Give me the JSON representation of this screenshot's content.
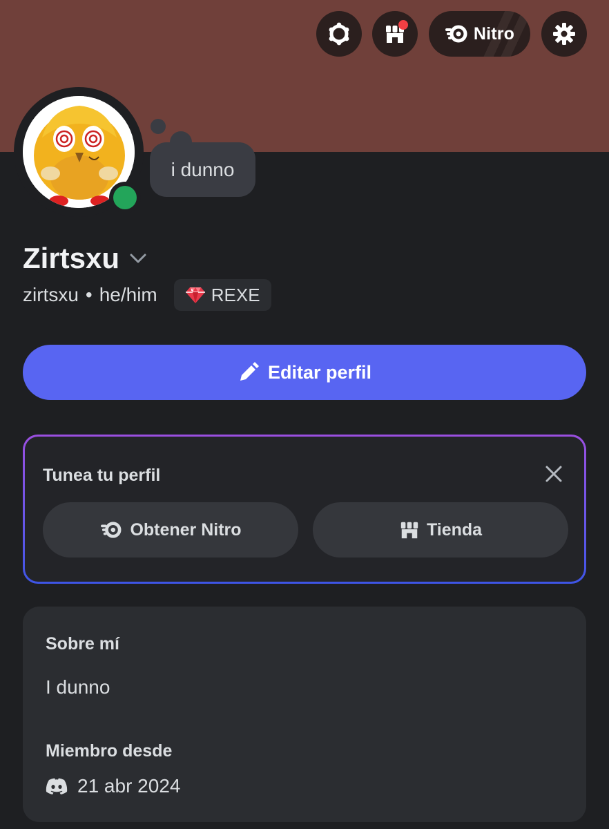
{
  "header": {
    "nitro_label": "Nitro",
    "icons": [
      "quests-icon",
      "shop-icon",
      "nitro-icon",
      "gear-icon"
    ],
    "notification": true
  },
  "profile": {
    "custom_status": "i dunno",
    "display_name": "Zirtsxu",
    "username": "zirtsxu",
    "separator": "•",
    "pronouns": "he/him",
    "clan_tag": "REXE",
    "status": "online",
    "status_color": "#23a55a",
    "banner_color": "#70403a"
  },
  "actions": {
    "edit_profile_label": "Editar perfil",
    "accent_color": "#5865f2"
  },
  "tune_card": {
    "title": "Tunea tu perfil",
    "get_nitro_label": "Obtener Nitro",
    "shop_label": "Tienda"
  },
  "about": {
    "about_heading": "Sobre mí",
    "about_text": "I dunno",
    "member_since_heading": "Miembro desde",
    "member_since_date": "21 abr 2024"
  }
}
